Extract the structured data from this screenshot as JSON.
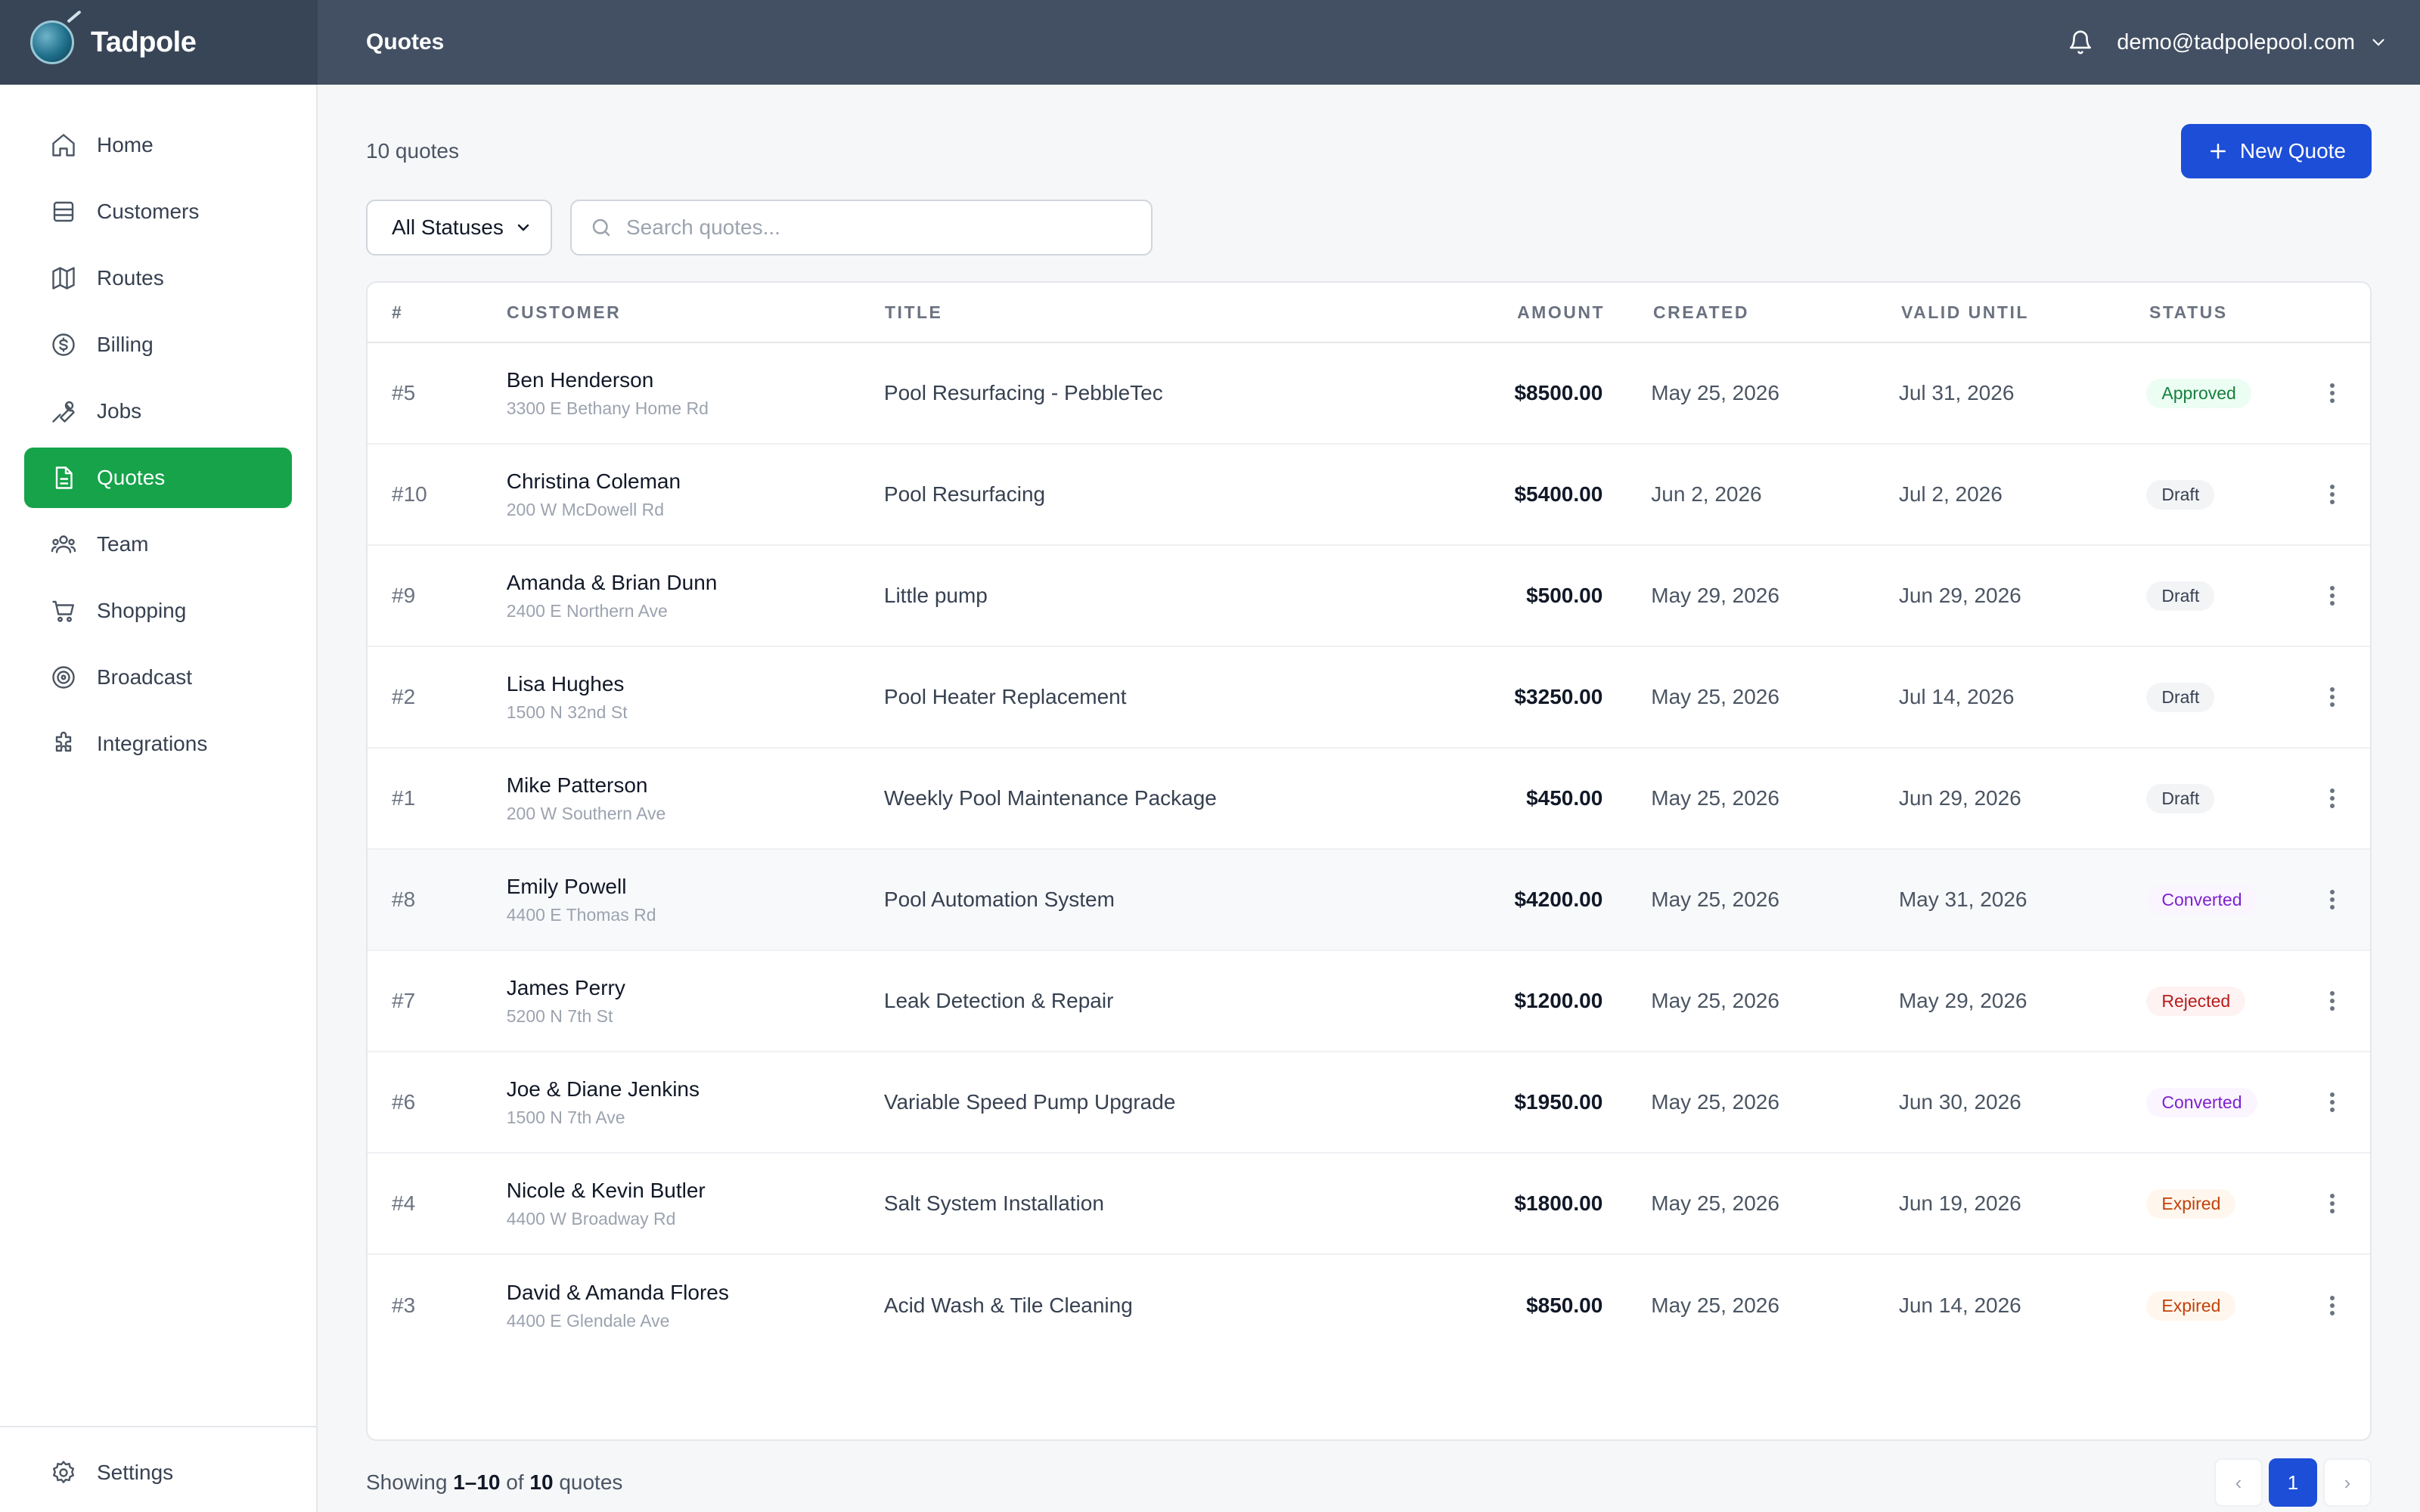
{
  "brand": {
    "name": "Tadpole"
  },
  "header": {
    "title": "Quotes",
    "user_email": "demo@tadpolepool.com"
  },
  "sidebar": {
    "items": [
      {
        "label": "Home",
        "icon": "home-icon"
      },
      {
        "label": "Customers",
        "icon": "customers-icon"
      },
      {
        "label": "Routes",
        "icon": "map-icon"
      },
      {
        "label": "Billing",
        "icon": "dollar-icon"
      },
      {
        "label": "Jobs",
        "icon": "wrench-icon"
      },
      {
        "label": "Quotes",
        "icon": "document-icon",
        "active": true
      },
      {
        "label": "Team",
        "icon": "team-icon"
      },
      {
        "label": "Shopping",
        "icon": "cart-icon"
      },
      {
        "label": "Broadcast",
        "icon": "broadcast-icon"
      },
      {
        "label": "Integrations",
        "icon": "puzzle-icon"
      }
    ],
    "settings_label": "Settings"
  },
  "main": {
    "count_text": "10 quotes",
    "new_button_label": "New Quote",
    "status_filter": {
      "selected": "All Statuses"
    },
    "search": {
      "placeholder": "Search quotes..."
    },
    "columns": [
      "#",
      "Customer",
      "Title",
      "Amount",
      "Created",
      "Valid Until",
      "Status"
    ],
    "rows": [
      {
        "num": "#5",
        "name": "Ben Henderson",
        "address": "3300 E Bethany Home Rd",
        "title": "Pool Resurfacing - PebbleTec",
        "amount": "$8500.00",
        "created": "May 25, 2026",
        "valid": "Jul 31, 2026",
        "status": "Approved",
        "status_class": "b-approved"
      },
      {
        "num": "#10",
        "name": "Christina Coleman",
        "address": "200 W McDowell Rd",
        "title": "Pool Resurfacing",
        "amount": "$5400.00",
        "created": "Jun 2, 2026",
        "valid": "Jul 2, 2026",
        "status": "Draft",
        "status_class": "b-draft"
      },
      {
        "num": "#9",
        "name": "Amanda & Brian Dunn",
        "address": "2400 E Northern Ave",
        "title": "Little pump",
        "amount": "$500.00",
        "created": "May 29, 2026",
        "valid": "Jun 29, 2026",
        "status": "Draft",
        "status_class": "b-draft"
      },
      {
        "num": "#2",
        "name": "Lisa Hughes",
        "address": "1500 N 32nd St",
        "title": "Pool Heater Replacement",
        "amount": "$3250.00",
        "created": "May 25, 2026",
        "valid": "Jul 14, 2026",
        "status": "Draft",
        "status_class": "b-draft"
      },
      {
        "num": "#1",
        "name": "Mike Patterson",
        "address": "200 W Southern Ave",
        "title": "Weekly Pool Maintenance Package",
        "amount": "$450.00",
        "created": "May 25, 2026",
        "valid": "Jun 29, 2026",
        "status": "Draft",
        "status_class": "b-draft"
      },
      {
        "num": "#8",
        "name": "Emily Powell",
        "address": "4400 E Thomas Rd",
        "title": "Pool Automation System",
        "amount": "$4200.00",
        "created": "May 25, 2026",
        "valid": "May 31, 2026",
        "status": "Converted",
        "status_class": "b-converted"
      },
      {
        "num": "#7",
        "name": "James Perry",
        "address": "5200 N 7th St",
        "title": "Leak Detection & Repair",
        "amount": "$1200.00",
        "created": "May 25, 2026",
        "valid": "May 29, 2026",
        "status": "Rejected",
        "status_class": "b-rejected"
      },
      {
        "num": "#6",
        "name": "Joe & Diane Jenkins",
        "address": "1500 N 7th Ave",
        "title": "Variable Speed Pump Upgrade",
        "amount": "$1950.00",
        "created": "May 25, 2026",
        "valid": "Jun 30, 2026",
        "status": "Converted",
        "status_class": "b-converted"
      },
      {
        "num": "#4",
        "name": "Nicole & Kevin Butler",
        "address": "4400 W Broadway Rd",
        "title": "Salt System Installation",
        "amount": "$1800.00",
        "created": "May 25, 2026",
        "valid": "Jun 19, 2026",
        "status": "Expired",
        "status_class": "b-expired"
      },
      {
        "num": "#3",
        "name": "David & Amanda Flores",
        "address": "4400 E Glendale Ave",
        "title": "Acid Wash & Tile Cleaning",
        "amount": "$850.00",
        "created": "May 25, 2026",
        "valid": "Jun 14, 2026",
        "status": "Expired",
        "status_class": "b-expired"
      }
    ],
    "pagination": {
      "showing_prefix": "Showing",
      "range": "1–10",
      "of_text": "of",
      "total": "10",
      "suffix": "quotes",
      "current_page": "1",
      "prev_label": "‹",
      "next_label": "›"
    }
  },
  "colors": {
    "topbar": "#435063",
    "accent_green": "#16a34a",
    "accent_blue": "#1d4ed8"
  }
}
